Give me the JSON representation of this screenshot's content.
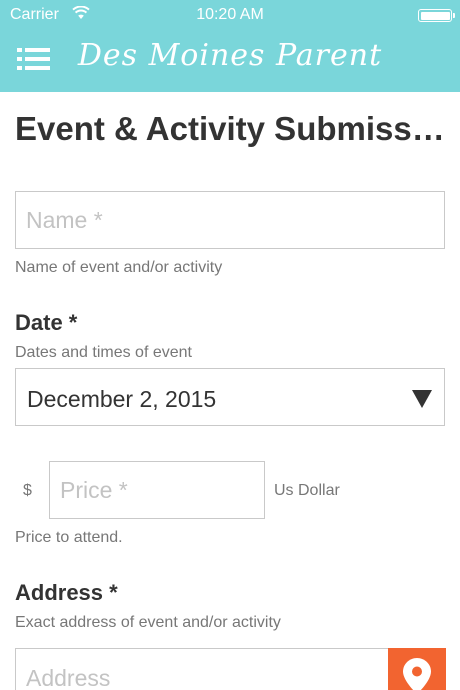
{
  "status_bar": {
    "carrier": "Carrier",
    "time": "10:20 AM"
  },
  "header": {
    "brand": "Des Moines Parent",
    "background": "#7ad6da"
  },
  "page": {
    "title": "Event & Activity Submiss…"
  },
  "form": {
    "name": {
      "placeholder": "Name *",
      "help": "Name of event and/or activity"
    },
    "date": {
      "label": "Date *",
      "help": "Dates and times of event",
      "value": "December 2, 2015"
    },
    "price": {
      "currency": "$",
      "placeholder": "Price *",
      "unit": "Us Dollar",
      "help": "Price to attend."
    },
    "address": {
      "label": "Address *",
      "help": "Exact address of event and/or activity",
      "placeholder": "Address"
    }
  },
  "icons": {
    "menu": "hamburger-menu-icon",
    "dropdown": "triangle-down-icon",
    "location": "map-pin-icon"
  },
  "colors": {
    "accent": "#7ad6da",
    "map_button": "#f26430"
  }
}
